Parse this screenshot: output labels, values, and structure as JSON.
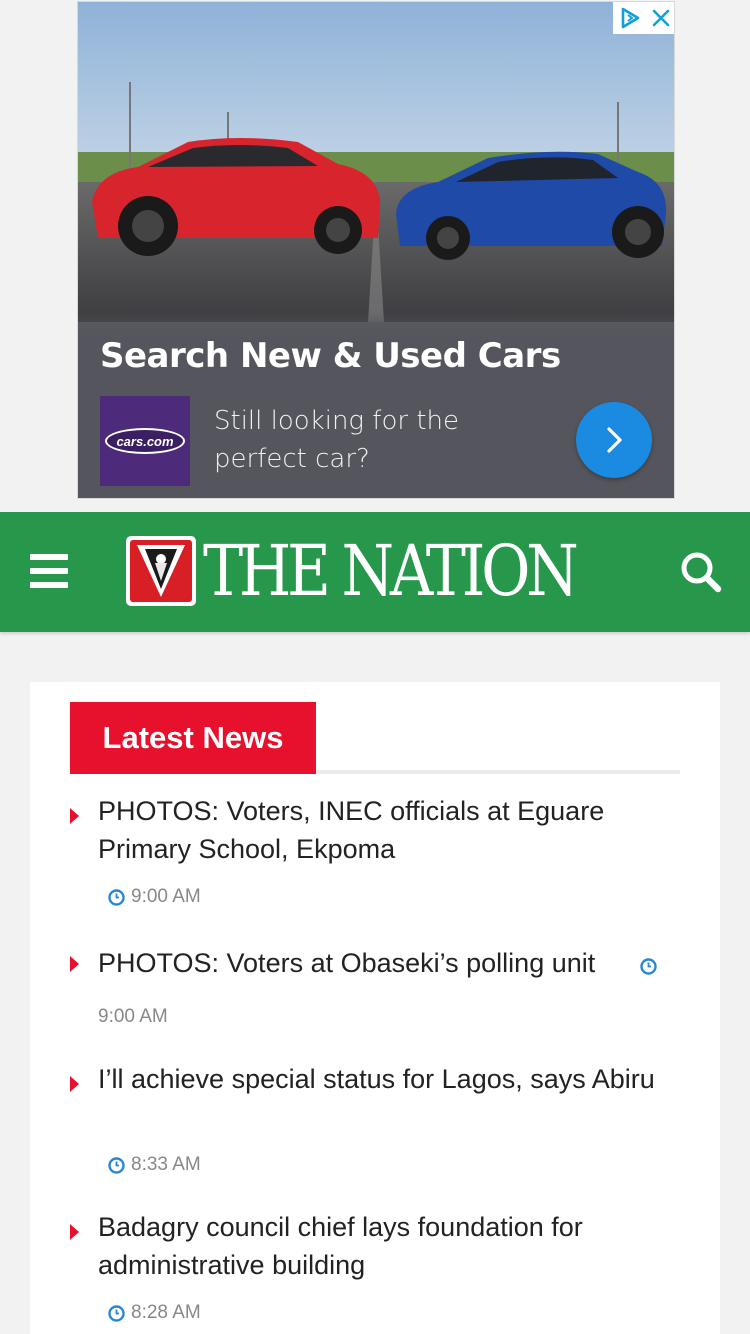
{
  "ad": {
    "title": "Search New & Used Cars",
    "description": "Still looking for the perfect car?",
    "advertiser_logo": "cars.com",
    "cta_icon": "chevron-right-icon",
    "choices_icon": "adchoices-icon",
    "close_icon": "close-icon"
  },
  "header": {
    "site_name": "THE NATION",
    "menu_icon": "hamburger-menu-icon",
    "search_icon": "search-icon",
    "brand_color": "#26974b"
  },
  "section": {
    "tab_label": "Latest News",
    "accent_color": "#e8112d"
  },
  "news": [
    {
      "headline": "PHOTOS: Voters, INEC officials at Eguare Primary School, Ekpoma",
      "time": "9:00 AM"
    },
    {
      "headline": "PHOTOS: Voters at Obaseki’s polling unit",
      "time": "9:00 AM"
    },
    {
      "headline": "I’ll achieve special status for Lagos, says Abiru",
      "time": "8:33 AM"
    },
    {
      "headline": "Badagry council chief lays foundation for administrative building",
      "time": "8:28 AM"
    }
  ]
}
